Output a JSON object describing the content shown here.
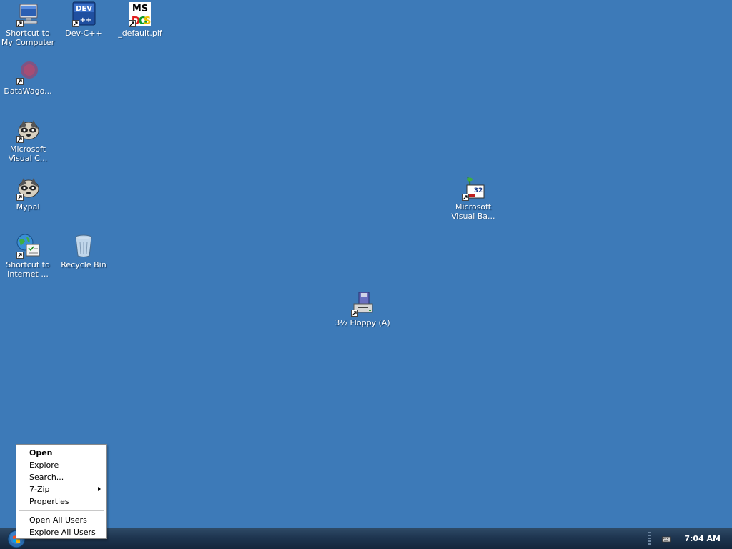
{
  "desktop": {
    "background_color": "#3d7ab8",
    "icons": [
      {
        "label": "Shortcut to My Computer",
        "icon": "computer-icon",
        "shortcut": true
      },
      {
        "label": "Dev-C++",
        "icon": "devcpp-icon",
        "shortcut": true
      },
      {
        "label": "_default.pif",
        "icon": "msdos-icon",
        "shortcut": true
      },
      {
        "label": "DataWago...",
        "icon": "datawagon-icon",
        "shortcut": true
      },
      {
        "label": "Microsoft Visual C...",
        "icon": "raccoon-icon",
        "shortcut": true
      },
      {
        "label": "Mypal",
        "icon": "raccoon-icon",
        "shortcut": true
      },
      {
        "label": "Shortcut to Internet ...",
        "icon": "internet-options-icon",
        "shortcut": true
      },
      {
        "label": "Recycle Bin",
        "icon": "recycle-bin-icon",
        "shortcut": false
      },
      {
        "label": "Microsoft Visual Ba...",
        "icon": "visual-basic-icon",
        "shortcut": true
      },
      {
        "label": "3½ Floppy (A)",
        "icon": "floppy-drive-icon",
        "shortcut": true
      }
    ]
  },
  "context_menu": {
    "items": [
      {
        "label": "Open",
        "bold": true
      },
      {
        "label": "Explore"
      },
      {
        "label": "Search..."
      },
      {
        "label": "7-Zip",
        "submenu": true
      },
      {
        "label": "Properties"
      },
      {
        "label": "Open All Users"
      },
      {
        "label": "Explore All Users"
      }
    ]
  },
  "taskbar": {
    "start_icon": "windows-orb-icon",
    "tray_icon": "keyboard-icon",
    "clock": "7:04 AM"
  }
}
